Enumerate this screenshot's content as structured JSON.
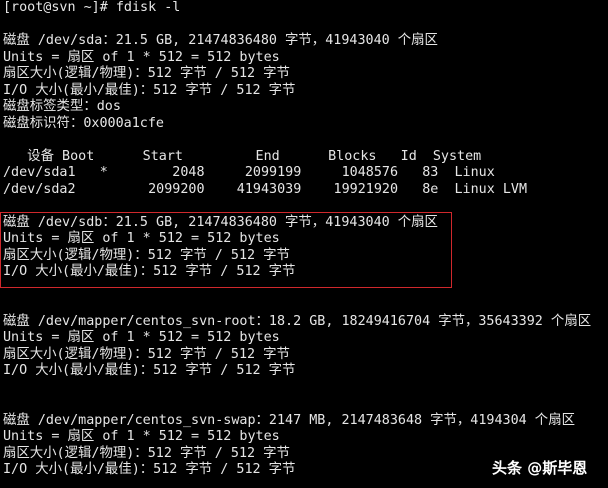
{
  "terminal": {
    "lines": [
      "[root@svn ~]# fdisk -l",
      "",
      "磁盘 /dev/sda：21.5 GB, 21474836480 字节，41943040 个扇区",
      "Units = 扇区 of 1 * 512 = 512 bytes",
      "扇区大小(逻辑/物理)：512 字节 / 512 字节",
      "I/O 大小(最小/最佳)：512 字节 / 512 字节",
      "磁盘标签类型：dos",
      "磁盘标识符：0x000a1cfe",
      "",
      "   设备 Boot      Start         End      Blocks   Id  System",
      "/dev/sda1   *        2048     2099199     1048576   83  Linux",
      "/dev/sda2         2099200    41943039    19921920   8e  Linux LVM",
      "",
      "磁盘 /dev/sdb：21.5 GB, 21474836480 字节，41943040 个扇区",
      "Units = 扇区 of 1 * 512 = 512 bytes",
      "扇区大小(逻辑/物理)：512 字节 / 512 字节",
      "I/O 大小(最小/最佳)：512 字节 / 512 字节",
      "",
      "",
      "磁盘 /dev/mapper/centos_svn-root：18.2 GB, 18249416704 字节，35643392 个扇区",
      "Units = 扇区 of 1 * 512 = 512 bytes",
      "扇区大小(逻辑/物理)：512 字节 / 512 字节",
      "I/O 大小(最小/最佳)：512 字节 / 512 字节",
      "",
      "",
      "磁盘 /dev/mapper/centos_svn-swap：2147 MB, 2147483648 字节，4194304 个扇区",
      "Units = 扇区 of 1 * 512 = 512 bytes",
      "扇区大小(逻辑/物理)：512 字节 / 512 字节",
      "I/O 大小(最小/最佳)：512 字节 / 512 字节"
    ]
  },
  "watermark": "头条 @斯毕恩",
  "colors": {
    "background": "#000000",
    "text": "#e6e6e6",
    "highlight": "#d0282c"
  }
}
